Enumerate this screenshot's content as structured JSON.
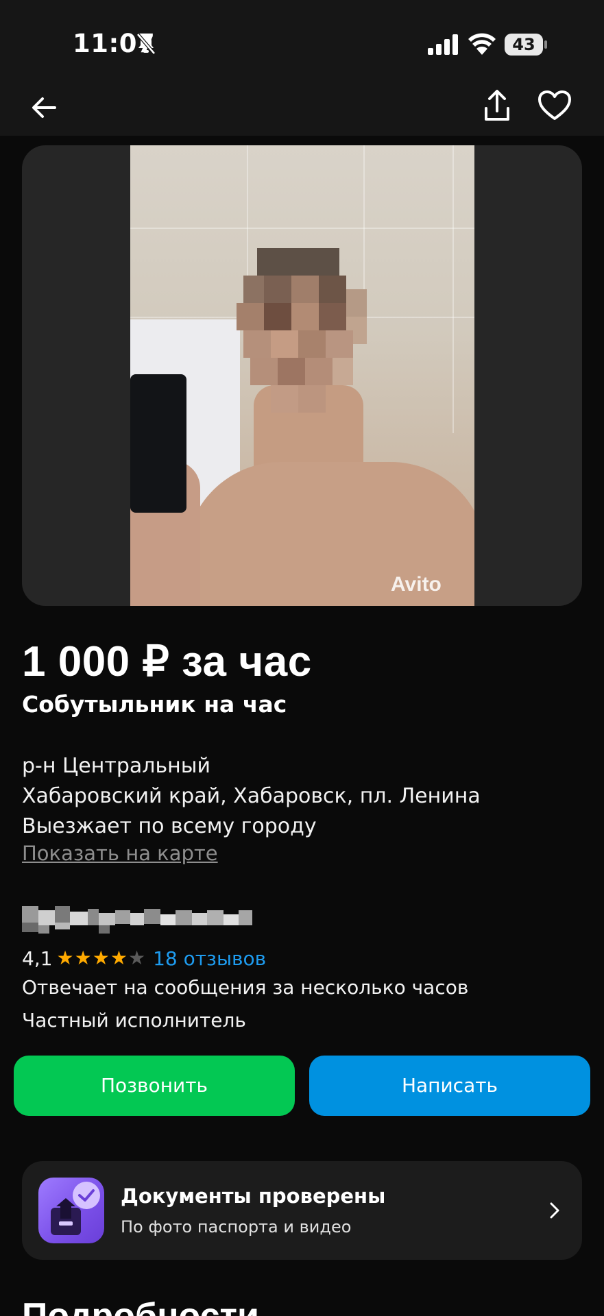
{
  "status_bar": {
    "time": "11:07",
    "battery": "43"
  },
  "topbar": {
    "back_icon": "arrow-left-icon",
    "share_icon": "share-icon",
    "favorite_icon": "heart-icon"
  },
  "listing": {
    "photo_watermark": "Avito",
    "price": "1 000 ₽ за час",
    "title": "Собутыльник на час",
    "address": {
      "district": "р-н Центральный",
      "location": "Хабаровский край, Хабаровск, пл. Ленина",
      "travel": "Выезжает по всему городу",
      "map_link": "Показать на карте"
    }
  },
  "seller": {
    "rating": "4,1",
    "stars_filled": 4,
    "stars_total": 5,
    "reviews_link": "18 отзывов",
    "response_time": "Отвечает на сообщения за несколько часов",
    "type": "Частный исполнитель"
  },
  "actions": {
    "call": "Позвонить",
    "message": "Написать"
  },
  "documents_card": {
    "title": "Документы проверены",
    "subtitle": "По фото паспорта и видео"
  },
  "section_heading": "Подробности",
  "colors": {
    "background": "#0a0a0a",
    "call_button": "#03c853",
    "message_button": "#0091e0",
    "link_blue": "#1e9cf0",
    "star": "#ffaa00"
  }
}
